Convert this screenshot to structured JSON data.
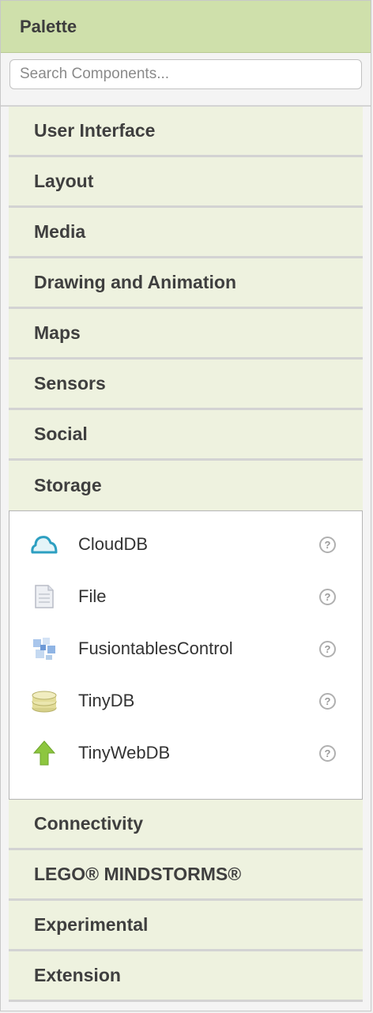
{
  "palette": {
    "title": "Palette",
    "search_placeholder": "Search Components..."
  },
  "categories_top": [
    {
      "label": "User Interface"
    },
    {
      "label": "Layout"
    },
    {
      "label": "Media"
    },
    {
      "label": "Drawing and Animation"
    },
    {
      "label": "Maps"
    },
    {
      "label": "Sensors"
    },
    {
      "label": "Social"
    },
    {
      "label": "Storage"
    }
  ],
  "storage_components": [
    {
      "label": "CloudDB",
      "icon": "cloud-icon",
      "help": "?"
    },
    {
      "label": "File",
      "icon": "file-icon",
      "help": "?"
    },
    {
      "label": "FusiontablesControl",
      "icon": "fusiontables-icon",
      "help": "?"
    },
    {
      "label": "TinyDB",
      "icon": "database-icon",
      "help": "?"
    },
    {
      "label": "TinyWebDB",
      "icon": "upload-arrow-icon",
      "help": "?"
    }
  ],
  "categories_bottom": [
    {
      "label": "Connectivity"
    },
    {
      "label": "LEGO® MINDSTORMS®"
    },
    {
      "label": "Experimental"
    },
    {
      "label": "Extension"
    }
  ],
  "colors": {
    "header_bg": "#cfe0ab",
    "category_bg": "#eef2df",
    "accent_cloud": "#3aa6c4",
    "accent_arrow": "#8dc63f"
  }
}
